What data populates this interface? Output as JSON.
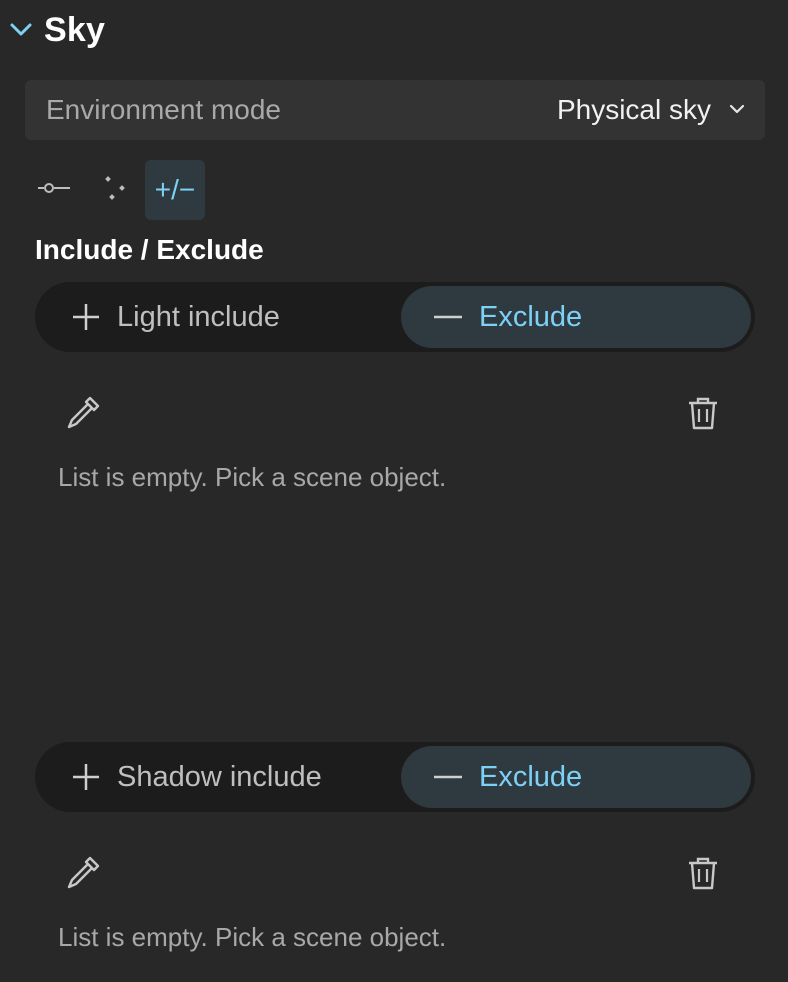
{
  "section": {
    "title": "Sky",
    "expanded_icon": "chevron-down-icon"
  },
  "environment": {
    "label": "Environment mode",
    "value": "Physical sky",
    "dropdown_icon": "chevron-down-icon"
  },
  "mode_tabs": [
    {
      "name": "light-link-icon",
      "active": false
    },
    {
      "name": "sparkle-points-icon",
      "active": false
    },
    {
      "name": "include-exclude-icon",
      "glyph": "+/−",
      "active": true
    }
  ],
  "include_exclude": {
    "title": "Include / Exclude",
    "light": {
      "include_label": "Light include",
      "exclude_label": "Exclude",
      "selected": "exclude",
      "empty_text": "List is empty. Pick a scene object."
    },
    "shadow": {
      "include_label": "Shadow include",
      "exclude_label": "Exclude",
      "selected": "exclude",
      "empty_text": "List is empty. Pick a scene object."
    }
  },
  "colors": {
    "background": "#282828",
    "accent": "#7dd1f5",
    "selected_bg": "#2f3940"
  }
}
